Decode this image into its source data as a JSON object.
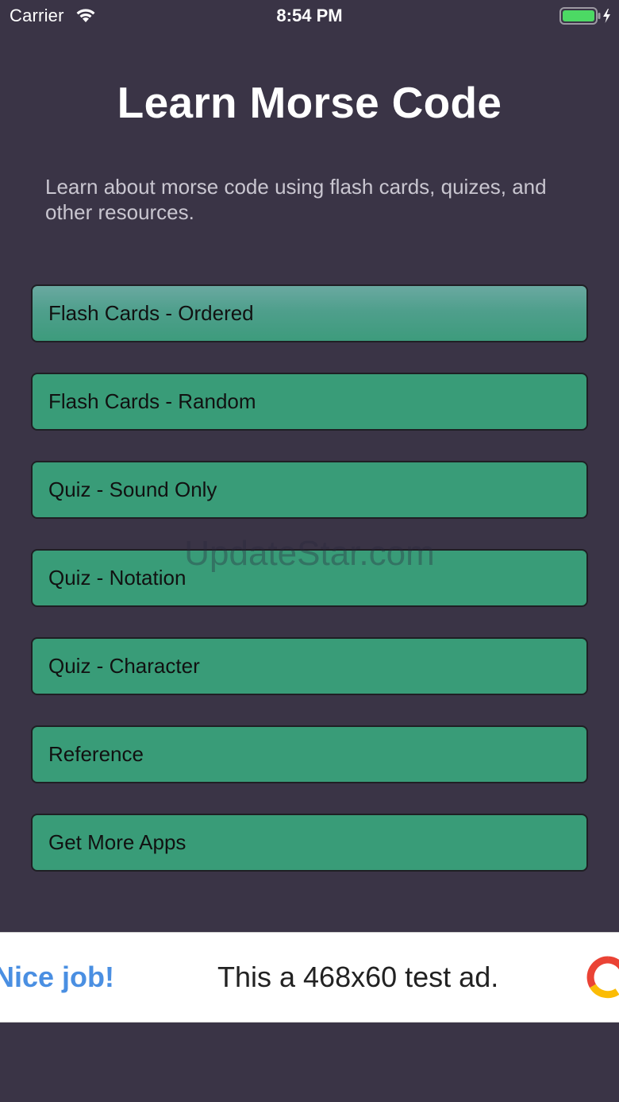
{
  "status_bar": {
    "carrier": "Carrier",
    "time": "8:54 PM",
    "icons": [
      "wifi-icon",
      "battery-icon",
      "charging-bolt-icon"
    ],
    "battery_color": "#4cd964"
  },
  "header": {
    "title": "Learn Morse Code",
    "subtitle": "Learn about morse code using flash cards, quizes, and other resources."
  },
  "menu": {
    "items": [
      {
        "label": "Flash Cards - Ordered",
        "selected": true
      },
      {
        "label": "Flash Cards - Random"
      },
      {
        "label": "Quiz - Sound Only"
      },
      {
        "label": "Quiz - Notation"
      },
      {
        "label": "Quiz - Character"
      },
      {
        "label": "Reference"
      },
      {
        "label": "Get More Apps"
      }
    ]
  },
  "watermark": "UpdateStar.com",
  "ad": {
    "headline": "Nice job!",
    "text": "This a 468x60 test ad.",
    "logo_icon": "ad-logo-icon"
  },
  "colors": {
    "background": "#3a3446",
    "button": "#399c78",
    "button_selected_top": "#6aa9a1",
    "button_border": "#1f1f24",
    "ad_headline": "#4a8fe2"
  }
}
